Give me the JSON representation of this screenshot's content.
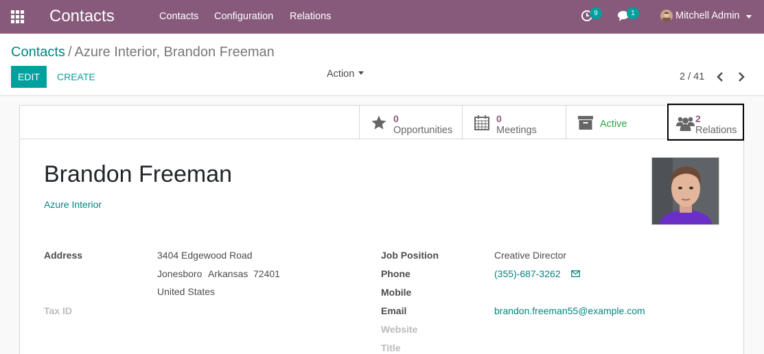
{
  "navbar": {
    "app_title": "Contacts",
    "menu": [
      "Contacts",
      "Configuration",
      "Relations"
    ],
    "activity_badge": "9",
    "messages_badge": "1",
    "user_name": "Mitchell Admin",
    "bg_color": "#875a7b"
  },
  "breadcrumb": {
    "parent": "Contacts",
    "separator": "/",
    "current": "Azure Interior, Brandon Freeman"
  },
  "toolbar": {
    "edit_label": "EDIT",
    "create_label": "CREATE",
    "action_label": "Action"
  },
  "pager": {
    "value": "2 / 41"
  },
  "stat_buttons": {
    "opportunities": {
      "value": "0",
      "label": "Opportunities",
      "icon": "star-icon"
    },
    "meetings": {
      "value": "0",
      "label": "Meetings",
      "icon": "calendar-icon"
    },
    "active": {
      "label": "Active",
      "icon": "archive-icon"
    },
    "relations": {
      "value": "2",
      "label": "Relations",
      "icon": "users-icon"
    }
  },
  "partner": {
    "name": "Brandon Freeman",
    "company": "Azure Interior"
  },
  "left_fields": {
    "address_label": "Address",
    "street": "3404 Edgewood Road",
    "city": "Jonesboro",
    "state": "Arkansas",
    "zip": "72401",
    "country": "United States",
    "tax_id_label": "Tax ID"
  },
  "right_fields": {
    "job_position_label": "Job Position",
    "job_position": "Creative Director",
    "phone_label": "Phone",
    "phone": "(355)-687-3262",
    "mobile_label": "Mobile",
    "email_label": "Email",
    "email": "brandon.freeman55@example.com",
    "website_label": "Website",
    "title_label": "Title"
  },
  "colors": {
    "primary": "#00a09d",
    "link": "#00857f",
    "stat_value": "#875a7b",
    "active_green": "#28a745"
  }
}
